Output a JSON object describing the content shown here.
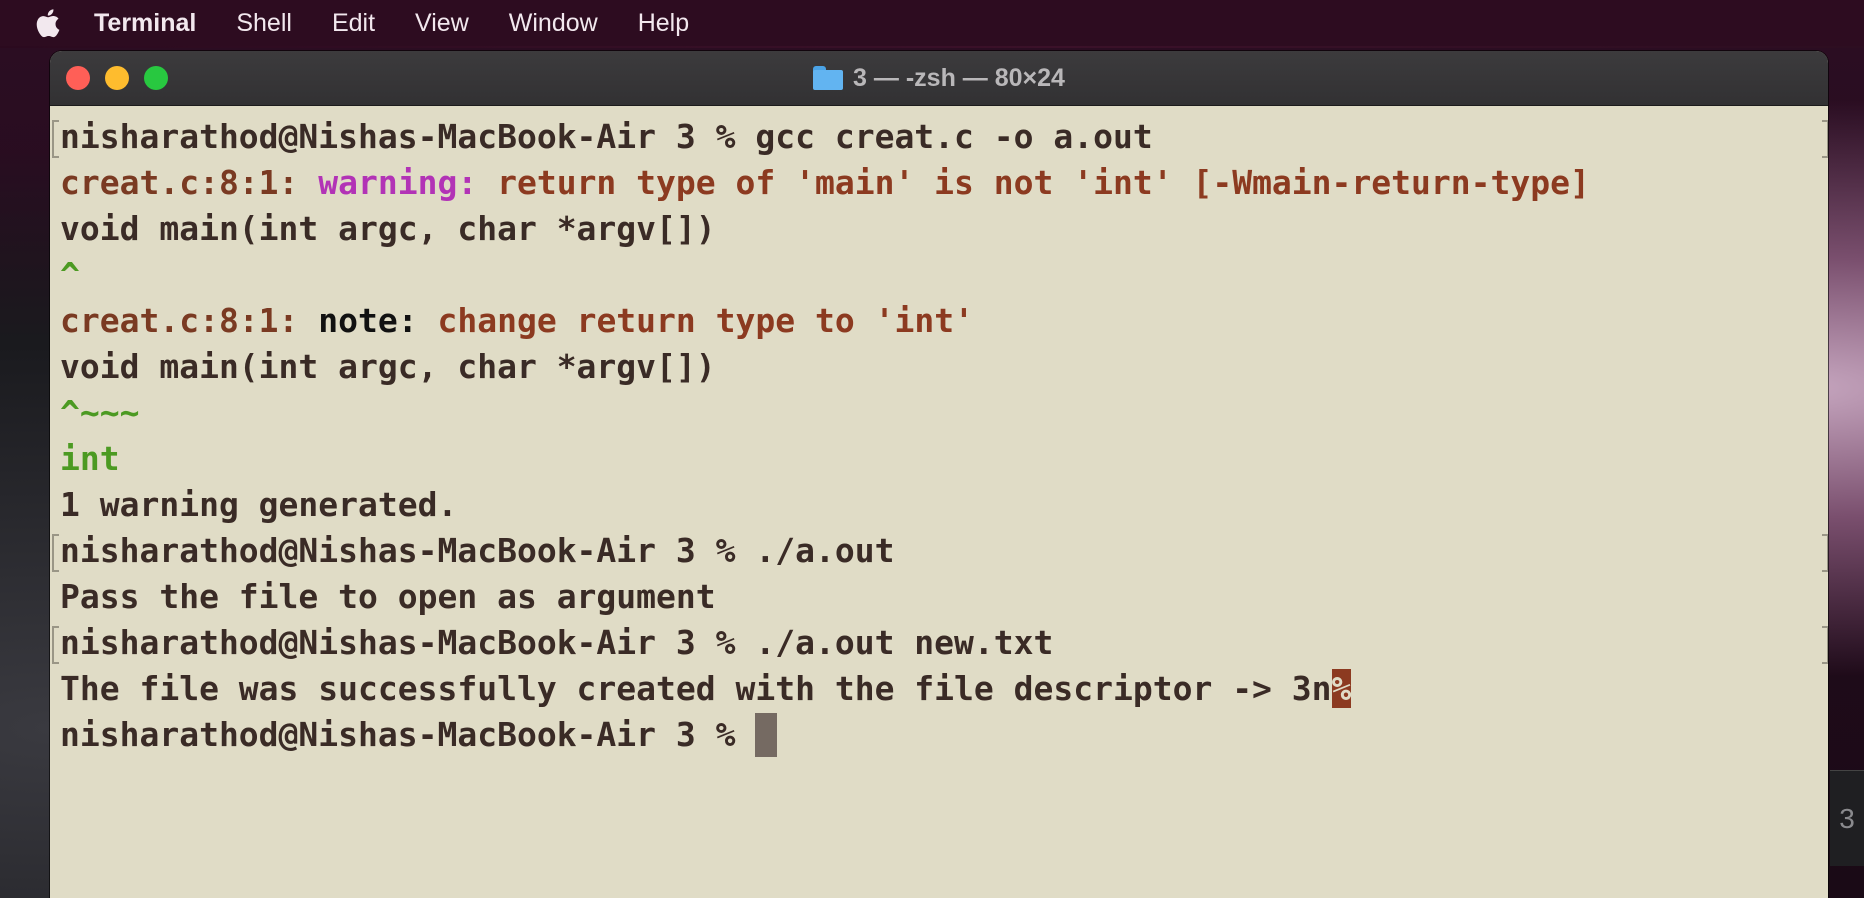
{
  "menubar": {
    "app_name": "Terminal",
    "items": [
      "Shell",
      "Edit",
      "View",
      "Window",
      "Help"
    ]
  },
  "window": {
    "title": "3 — -zsh — 80×24"
  },
  "terminal": {
    "line0": {
      "text": "nisharathod@Nishas-MacBook-Air 3 % gcc creat.c -o a.out"
    },
    "line1": {
      "loc": "creat.c:8:1: ",
      "label": "warning: ",
      "text": "return type of 'main' is not 'int' [-Wmain-return-type]"
    },
    "line2": {
      "text": "void main(int argc, char *argv[])"
    },
    "line3": {
      "text": "^"
    },
    "line4": {
      "loc": "creat.c:8:1: ",
      "label": "note: ",
      "text": "change return type to 'int'"
    },
    "line5": {
      "text": "void main(int argc, char *argv[])"
    },
    "line6": {
      "text": "^~~~"
    },
    "line7": {
      "text": "int"
    },
    "line8": {
      "text": "1 warning generated."
    },
    "line9": {
      "text": "nisharathod@Nishas-MacBook-Air 3 % ./a.out"
    },
    "line10": {
      "text": "Pass the file to open as argument"
    },
    "line11": {
      "text": "nisharathod@Nishas-MacBook-Air 3 % ./a.out new.txt"
    },
    "line12": {
      "text": "The file was successfully created with the file descriptor -> 3n",
      "marker": "%"
    },
    "line13": {
      "text": "nisharathod@Nishas-MacBook-Air 3 % "
    }
  },
  "side_panel": {
    "text": "3"
  },
  "colors": {
    "terminal_bg": "#e0dcc6",
    "warning": "#b233b6",
    "location": "#7a3a22",
    "green": "#4c9a22"
  }
}
